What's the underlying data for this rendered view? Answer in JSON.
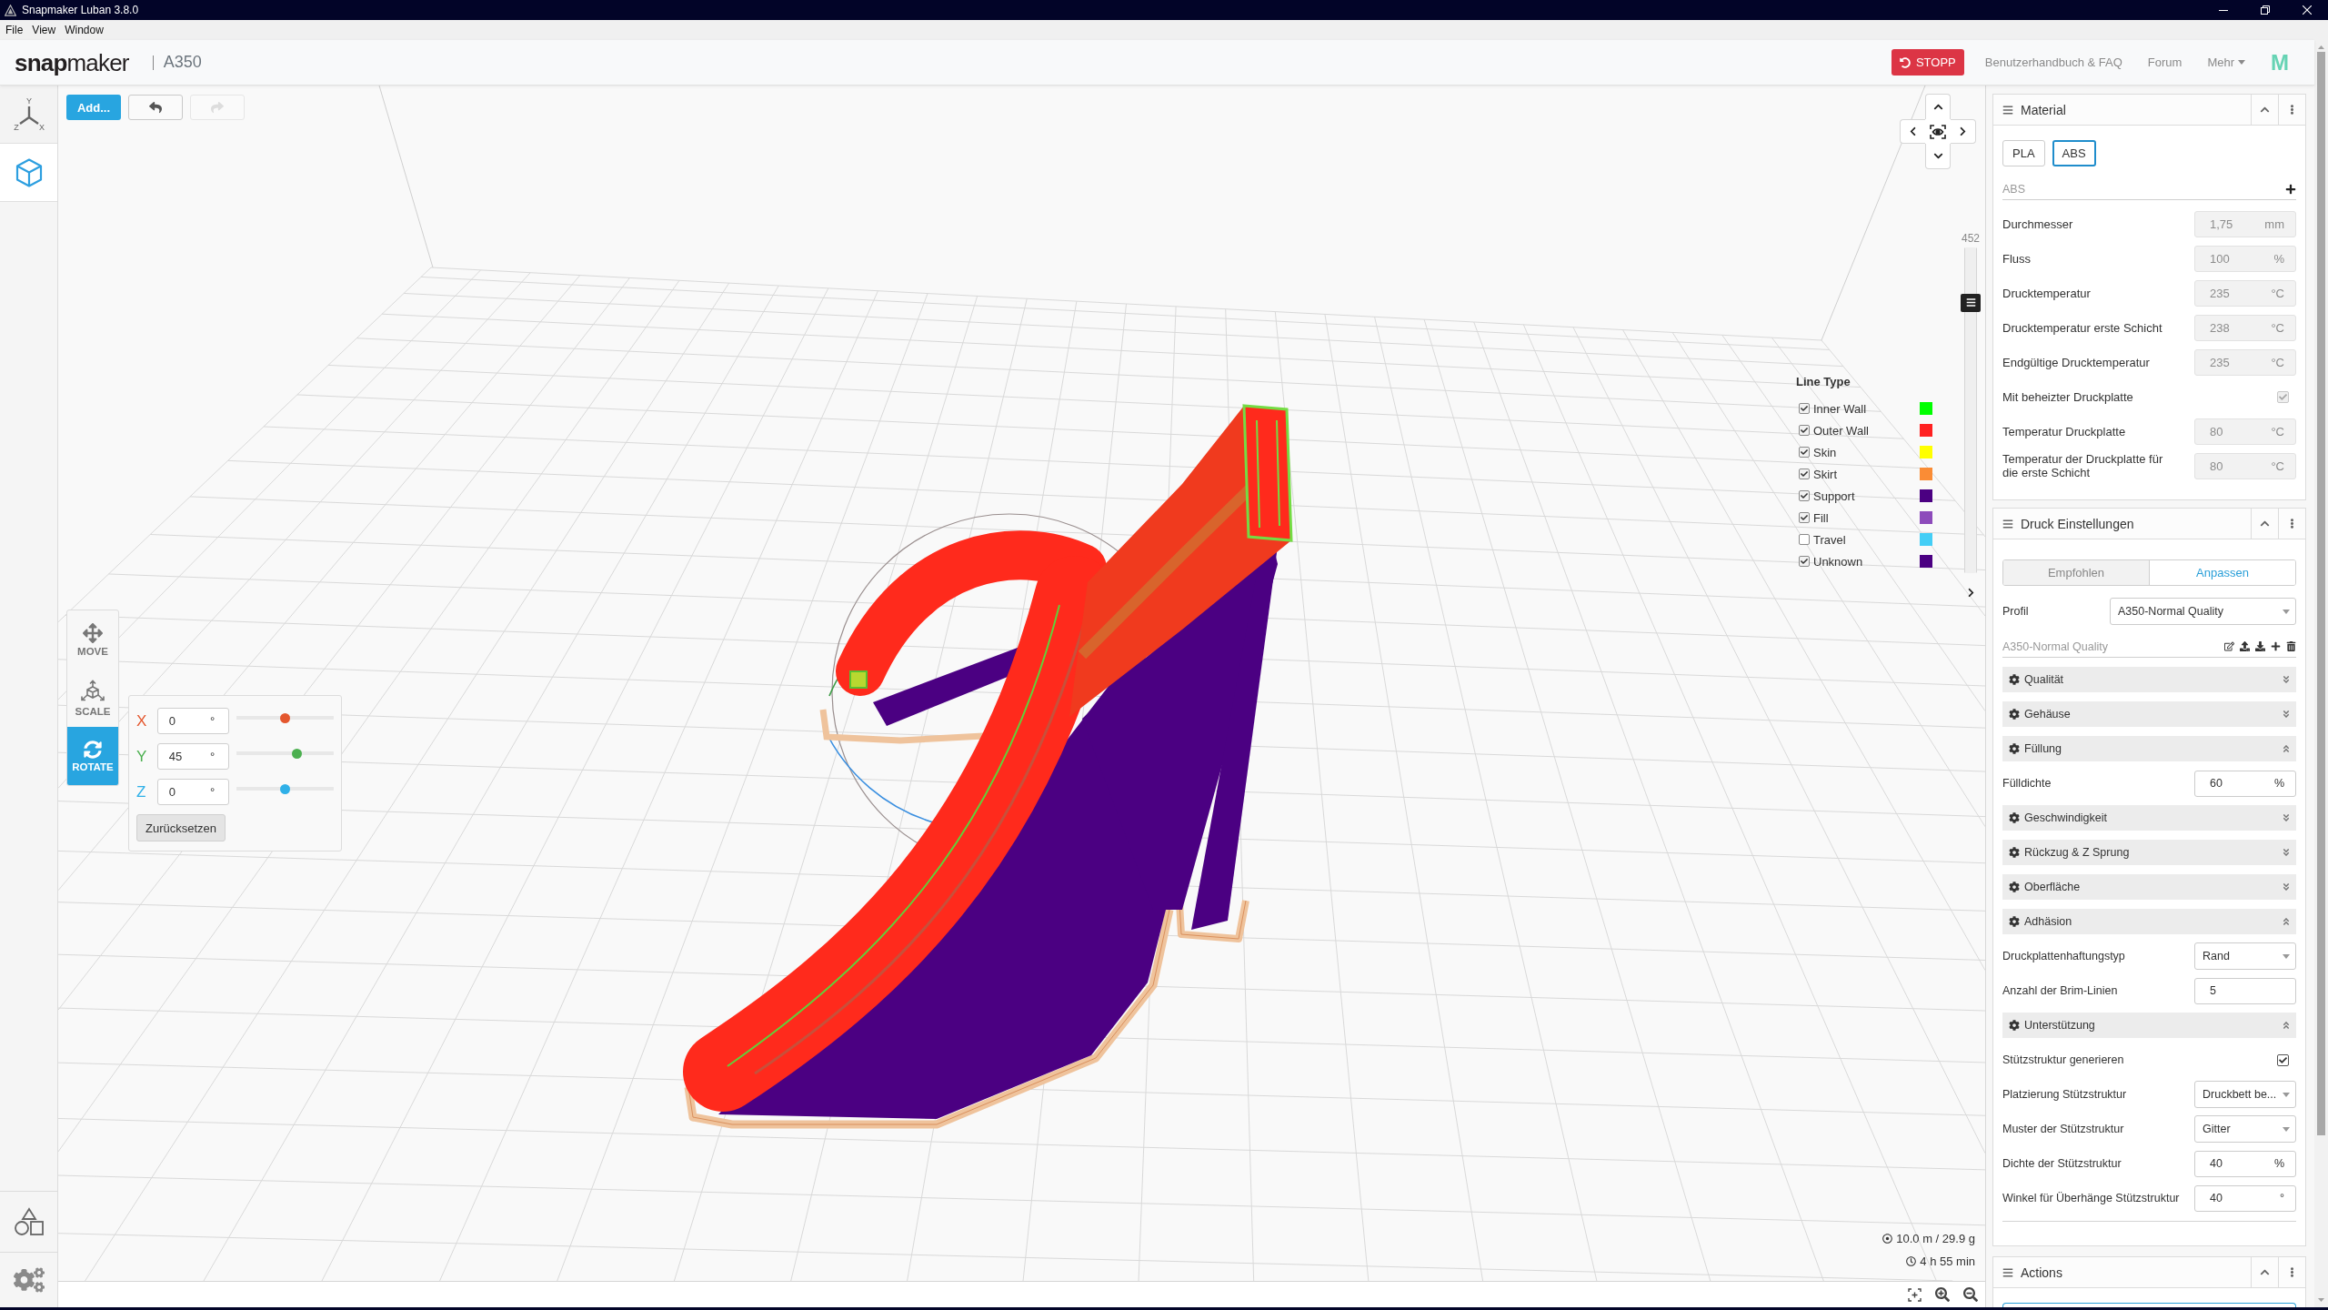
{
  "window": {
    "title": "Snapmaker Luban 3.8.0"
  },
  "menu": [
    "File",
    "View",
    "Window"
  ],
  "header": {
    "logo": "**snap**maker",
    "machine": "A350",
    "stop_button": "STOPP",
    "links": [
      {
        "label": "Benutzerhandbuch & FAQ",
        "kind": "link"
      },
      {
        "label": "Forum",
        "kind": "link"
      },
      {
        "label": "Mehr",
        "kind": "dropdown"
      }
    ],
    "brand_mark": "M"
  },
  "sidebar": {
    "items": [
      {
        "kind": "axes",
        "selected": false,
        "axis_labels": [
          "Y",
          "Z",
          "X"
        ]
      },
      {
        "kind": "model",
        "selected": true
      }
    ],
    "bottom_items": [
      {
        "kind": "shapes"
      },
      {
        "kind": "settings"
      }
    ]
  },
  "toolbar": {
    "add_button": "Add...",
    "undo": {
      "disabled": false
    },
    "redo": {
      "disabled": true
    }
  },
  "transform_tools": [
    {
      "kind": "move",
      "label": "MOVE",
      "selected": false
    },
    {
      "kind": "scale",
      "label": "SCALE",
      "selected": false
    },
    {
      "kind": "rotate",
      "label": "ROTATE",
      "selected": true
    }
  ],
  "rotate_panel": {
    "axes": [
      {
        "axis": "X",
        "value": "0",
        "unit": "°",
        "color": "#e4572e",
        "level": 0.5
      },
      {
        "axis": "Y",
        "value": "45",
        "unit": "°",
        "color": "#4cb050",
        "level": 0.63
      },
      {
        "axis": "Z",
        "value": "0",
        "unit": "°",
        "color": "#2fb0e8",
        "level": 0.5
      }
    ],
    "reset_button": "Zurücksetzen"
  },
  "layer_slider": {
    "value": "452",
    "level": 0.85
  },
  "line_types": {
    "title": "Line Type",
    "items": [
      {
        "label": "Inner Wall",
        "checked": true,
        "color": "#00ff00"
      },
      {
        "label": "Outer Wall",
        "checked": true,
        "color": "#ff2121"
      },
      {
        "label": "Skin",
        "checked": true,
        "color": "#ffff00"
      },
      {
        "label": "Skirt",
        "checked": true,
        "color": "#fa8c35"
      },
      {
        "label": "Support",
        "checked": true,
        "color": "#4b0082"
      },
      {
        "label": "Fill",
        "checked": true,
        "color": "#8d4bbb"
      },
      {
        "label": "Travel",
        "checked": false,
        "color": "#44cef6"
      },
      {
        "label": "Unknown",
        "checked": true,
        "color": "#4b0082"
      }
    ]
  },
  "print_stats": [
    {
      "kind": "filament",
      "text": "10.0 m / 29.9 g"
    },
    {
      "kind": "time",
      "text": "4 h 55 min"
    }
  ],
  "material": {
    "title": "Material",
    "expanded": true,
    "presets": [
      {
        "label": "PLA",
        "selected": false
      },
      {
        "label": "ABS",
        "selected": true
      }
    ],
    "current": "ABS",
    "fields": [
      {
        "label": "Durchmesser",
        "kind": "input",
        "value": "1,75",
        "unit": "mm",
        "disabled": true
      },
      {
        "label": "Fluss",
        "kind": "input",
        "value": "100",
        "unit": "%",
        "disabled": true
      },
      {
        "label": "Drucktemperatur",
        "kind": "input",
        "value": "235",
        "unit": "°C",
        "disabled": true
      },
      {
        "label": "Drucktemperatur erste Schicht",
        "kind": "input",
        "value": "238",
        "unit": "°C",
        "disabled": true
      },
      {
        "label": "Endgültige Drucktemperatur",
        "kind": "input",
        "value": "235",
        "unit": "°C",
        "disabled": true
      },
      {
        "label": "Mit beheizter Druckplatte",
        "kind": "checkbox",
        "checked": true,
        "disabled": true
      },
      {
        "label": "Temperatur Druckplatte",
        "kind": "input",
        "value": "80",
        "unit": "°C",
        "disabled": true
      },
      {
        "label": "Temperatur der Druckplatte für die erste Schicht",
        "kind": "input",
        "value": "80",
        "unit": "°C",
        "disabled": true
      }
    ]
  },
  "print_settings": {
    "title": "Druck Einstellungen",
    "expanded": true,
    "tabs": [
      {
        "label": "Empfohlen",
        "selected": false
      },
      {
        "label": "Anpassen",
        "selected": true
      }
    ],
    "profile": {
      "label": "Profil",
      "value": "A350-Normal Quality"
    },
    "profile_name": "A350-Normal Quality",
    "sections": [
      {
        "title": "Qualität",
        "expanded": false
      },
      {
        "title": "Gehäuse",
        "expanded": false
      },
      {
        "title": "Füllung",
        "expanded": true,
        "fields": [
          {
            "label": "Fülldichte",
            "kind": "input",
            "value": "60",
            "unit": "%"
          }
        ]
      },
      {
        "title": "Geschwindigkeit",
        "expanded": false
      },
      {
        "title": "Rückzug & Z Sprung",
        "expanded": false
      },
      {
        "title": "Oberfläche",
        "expanded": false
      },
      {
        "title": "Adhäsion",
        "expanded": true,
        "fields": [
          {
            "label": "Druckplattenhaftungstyp",
            "kind": "select",
            "value": "Rand"
          },
          {
            "label": "Anzahl der Brim-Linien",
            "kind": "input",
            "value": "5"
          }
        ]
      },
      {
        "title": "Unterstützung",
        "expanded": true,
        "fields": [
          {
            "label": "Stützstruktur generieren",
            "kind": "checkbox",
            "checked": true
          },
          {
            "label": "Platzierung Stützstruktur",
            "kind": "select",
            "value": "Druckbett be..."
          },
          {
            "label": "Muster der Stützstruktur",
            "kind": "select",
            "value": "Gitter"
          },
          {
            "label": "Dichte der Stützstruktur",
            "kind": "input",
            "value": "40",
            "unit": "%"
          },
          {
            "label": "Winkel für Überhänge Stützstruktur",
            "kind": "input",
            "value": "40",
            "unit": "°"
          }
        ]
      }
    ]
  },
  "actions": {
    "title": "Actions",
    "expanded": true
  }
}
